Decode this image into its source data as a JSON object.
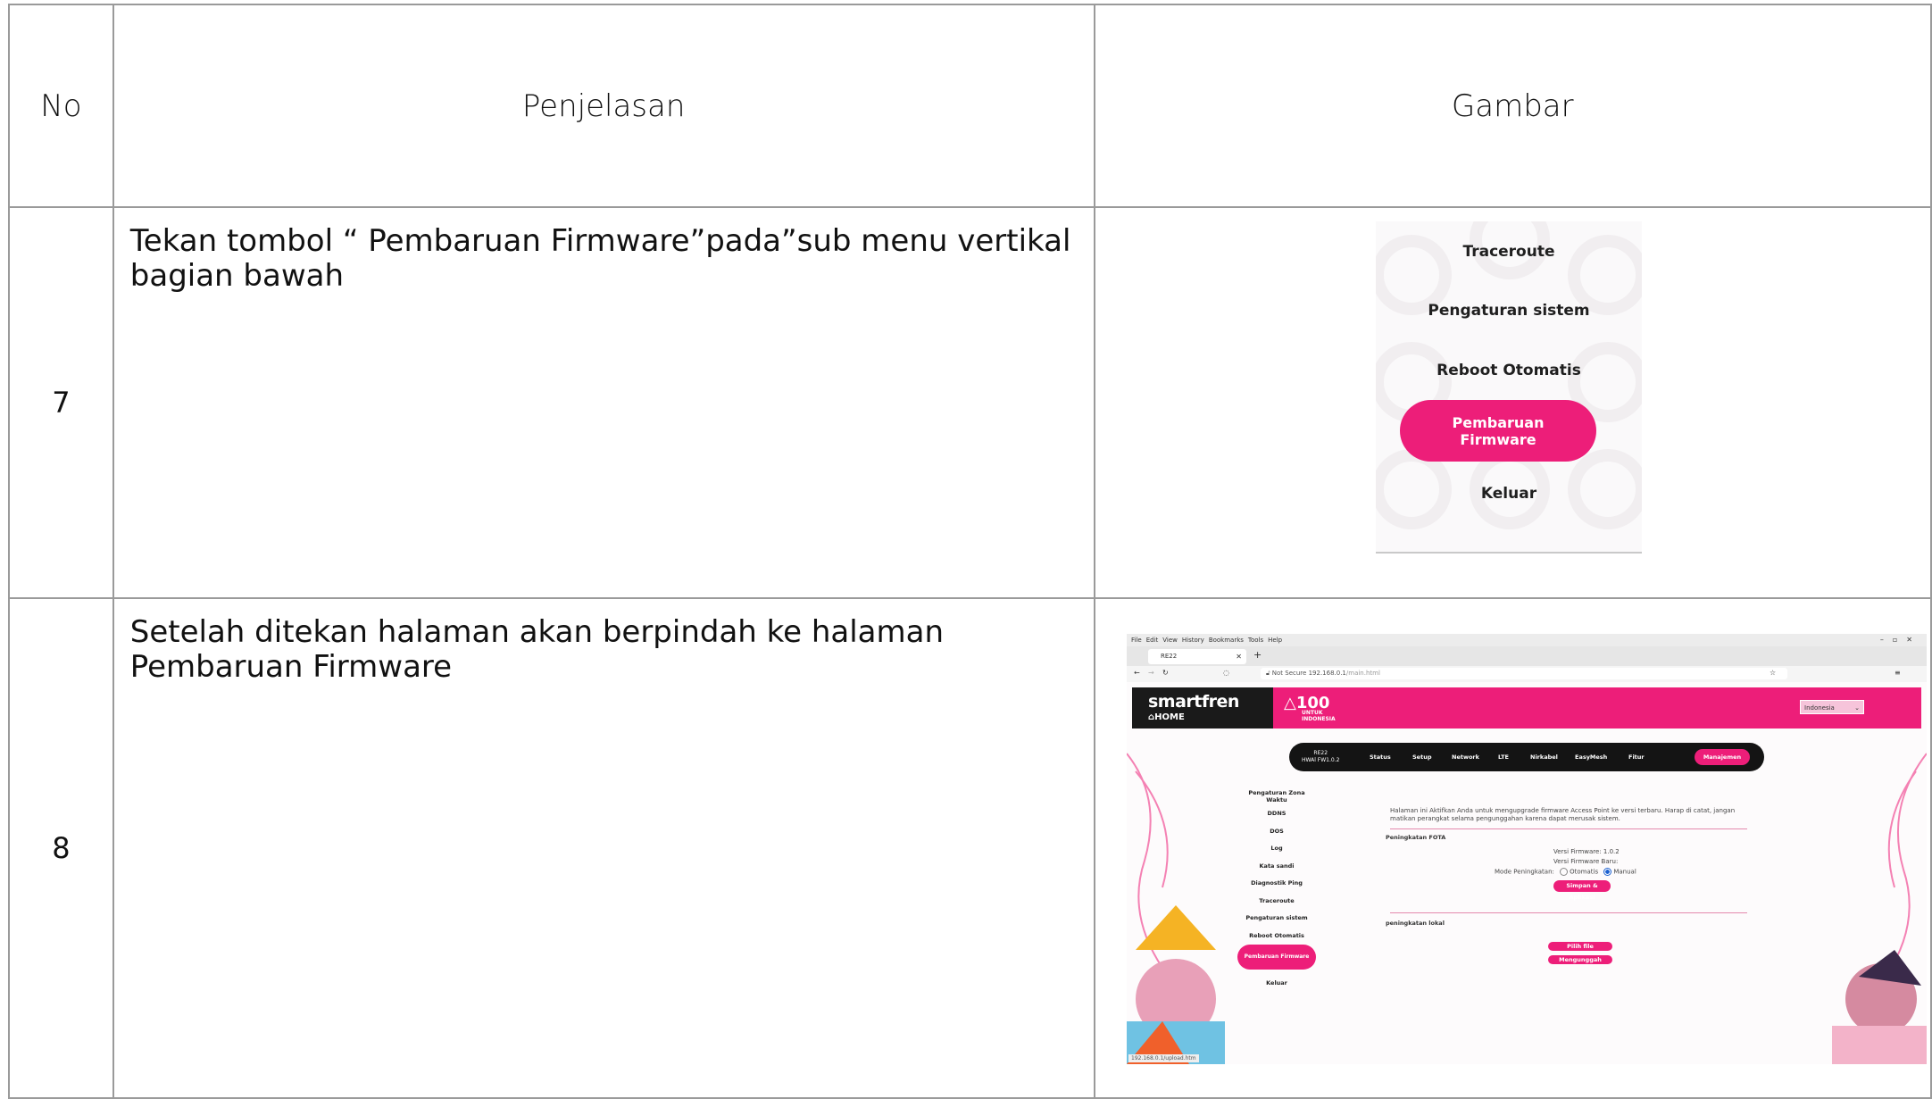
{
  "headers": {
    "no": "No",
    "penjelasan": "Penjelasan",
    "gambar": "Gambar"
  },
  "rows": [
    {
      "no": "7",
      "text": "Tekan tombol “ Pembaruan Firmware”pada”sub menu vertikal bagian bawah"
    },
    {
      "no": "8",
      "text": "Setelah ditekan halaman akan berpindah ke halaman Pembaruan Firmware"
    }
  ],
  "menu_crop": {
    "items": [
      "Traceroute",
      "Pengaturan sistem",
      "Reboot Otomatis",
      "Keluar"
    ],
    "active_line1": "Pembaruan",
    "active_line2": "Firmware",
    "accent": "#ed1e79"
  },
  "browser": {
    "menubar": [
      "File",
      "Edit",
      "View",
      "History",
      "Bookmarks",
      "Tools",
      "Help"
    ],
    "tab_title": "RE22",
    "url_not_secure": "Not Secure",
    "url": "192.168.0.1",
    "url_path": "/main.html",
    "brand": "smartfren",
    "brand_sub": "HOME",
    "logo_100": "100",
    "logo_100_sub1": "UNTUK",
    "logo_100_sub2": "INDONESIA",
    "language": "Indonesia",
    "device_model": "RE22",
    "device_fw": "HWAl  FW1.0.2",
    "nav": [
      "Status",
      "Setup",
      "Network",
      "LTE",
      "Nirkabel",
      "EasyMesh",
      "Fitur"
    ],
    "nav_active": "Manajemen",
    "side": [
      "Pengaturan Zona Waktu",
      "DDNS",
      "DOS",
      "Log",
      "Kata sandi",
      "Diagnostik Ping",
      "Traceroute",
      "Pengaturan sistem",
      "Reboot Otomatis"
    ],
    "side_active": "Pembaruan Firmware",
    "side_last": "Keluar",
    "info_text": "Halaman ini Aktifkan Anda untuk mengupgrade firmware Access Point ke versi terbaru. Harap di catat, jangan matikan perangkat selama pengunggahan karena dapat merusak sistem.",
    "fota_title": "Peningkatan FOTA",
    "fw_version_label": "Versi Firmware: 1.0.2",
    "fw_new_label": "Versi Firmware Baru:",
    "mode_label": "Mode Peningkatan:",
    "mode_auto": "Otomatis",
    "mode_manual": "Manual",
    "save_button": "Simpan & Aplikasi",
    "local_title": "peningkatan lokal",
    "choose_file": "Pilih file",
    "upload": "Mengunggah",
    "status_url": "192.168.0.1/upload.htm"
  }
}
